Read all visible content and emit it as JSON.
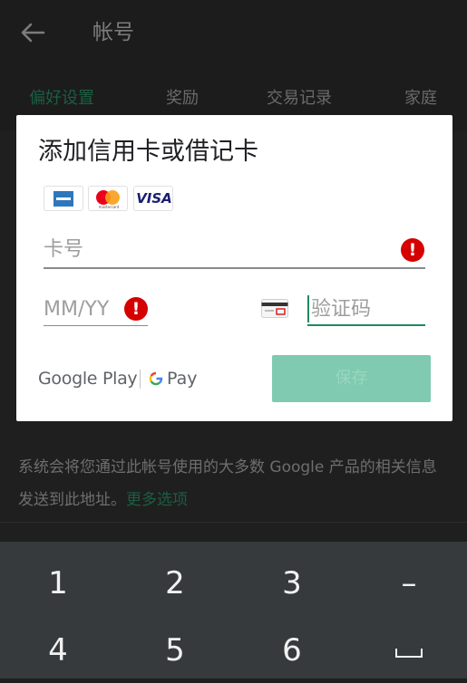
{
  "app_bar": {
    "title": "帐号",
    "back_icon": "arrow-left-icon"
  },
  "tabs": [
    {
      "label": "偏好设置",
      "active": true
    },
    {
      "label": "奖励",
      "active": false
    },
    {
      "label": "交易记录",
      "active": false
    },
    {
      "label": "家庭",
      "active": false
    }
  ],
  "background_info": {
    "text": "系统会将您通过此帐号使用的大多数 Google 产品的相关信息发送到此地址。",
    "link": "更多选项"
  },
  "dialog": {
    "title": "添加信用卡或借记卡",
    "card_logos": {
      "amex": "amex-logo",
      "mastercard_caption": "mastercard",
      "visa": "VISA"
    },
    "card_number": {
      "placeholder": "卡号",
      "value": "",
      "error_mark": "!"
    },
    "expiry": {
      "placeholder": "MM/YY",
      "value": "",
      "error_mark": "!"
    },
    "cvc": {
      "placeholder": "验证码",
      "value": "",
      "icon": "card-back-icon"
    },
    "branding": {
      "google_play": "Google Play",
      "pay": "Pay"
    },
    "save_label": "保存"
  },
  "keyboard": {
    "rows": [
      [
        "1",
        "2",
        "3",
        "–"
      ],
      [
        "4",
        "5",
        "6",
        "space"
      ]
    ]
  },
  "colors": {
    "accent_green": "#1e8a5e",
    "save_button_disabled": "#7fcab0",
    "error_red": "#d50000",
    "keyboard_bg": "#363a3c"
  }
}
